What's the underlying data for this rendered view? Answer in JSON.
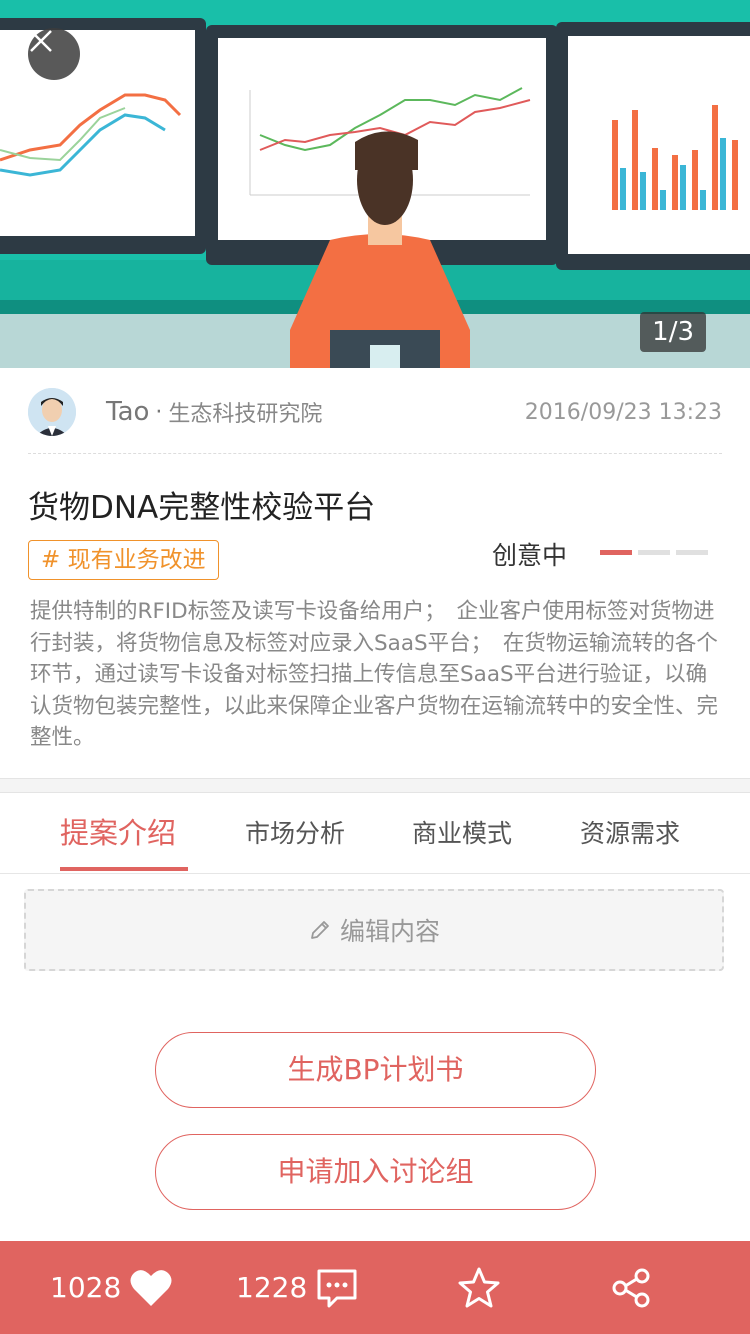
{
  "hero": {
    "counter": "1/3",
    "colors": {
      "background": "#19bfa9",
      "shirt": "#f36f43",
      "hair": "#4a3326"
    }
  },
  "author": {
    "name": "Tao",
    "separator": "·",
    "org": "生态科技研究院",
    "date": "2016/09/23 13:23"
  },
  "project": {
    "title": "货物DNA完整性校验平台",
    "tag": "# 现有业务改进",
    "status": "创意中",
    "stage_progress": {
      "active": 1,
      "total": 3
    },
    "description": "提供特制的RFID标签及读写卡设备给用户；　企业客户使用标签对货物进行封装，将货物信息及标签对应录入SaaS平台；　在货物运输流转的各个环节，通过读写卡设备对标签扫描上传信息至SaaS平台进行验证，以确认货物包装完整性，以此来保障企业客户货物在运输流转中的安全性、完整性。"
  },
  "tabs": [
    {
      "label": "提案介绍",
      "active": true
    },
    {
      "label": "市场分析",
      "active": false
    },
    {
      "label": "商业模式",
      "active": false
    },
    {
      "label": "资源需求",
      "active": false
    }
  ],
  "edit": {
    "label": "编辑内容"
  },
  "buttons": {
    "generate_bp": "生成BP计划书",
    "join_group": "申请加入讨论组"
  },
  "bottom_bar": {
    "likes": "1028",
    "comments": "1228",
    "color": "#e06460"
  }
}
